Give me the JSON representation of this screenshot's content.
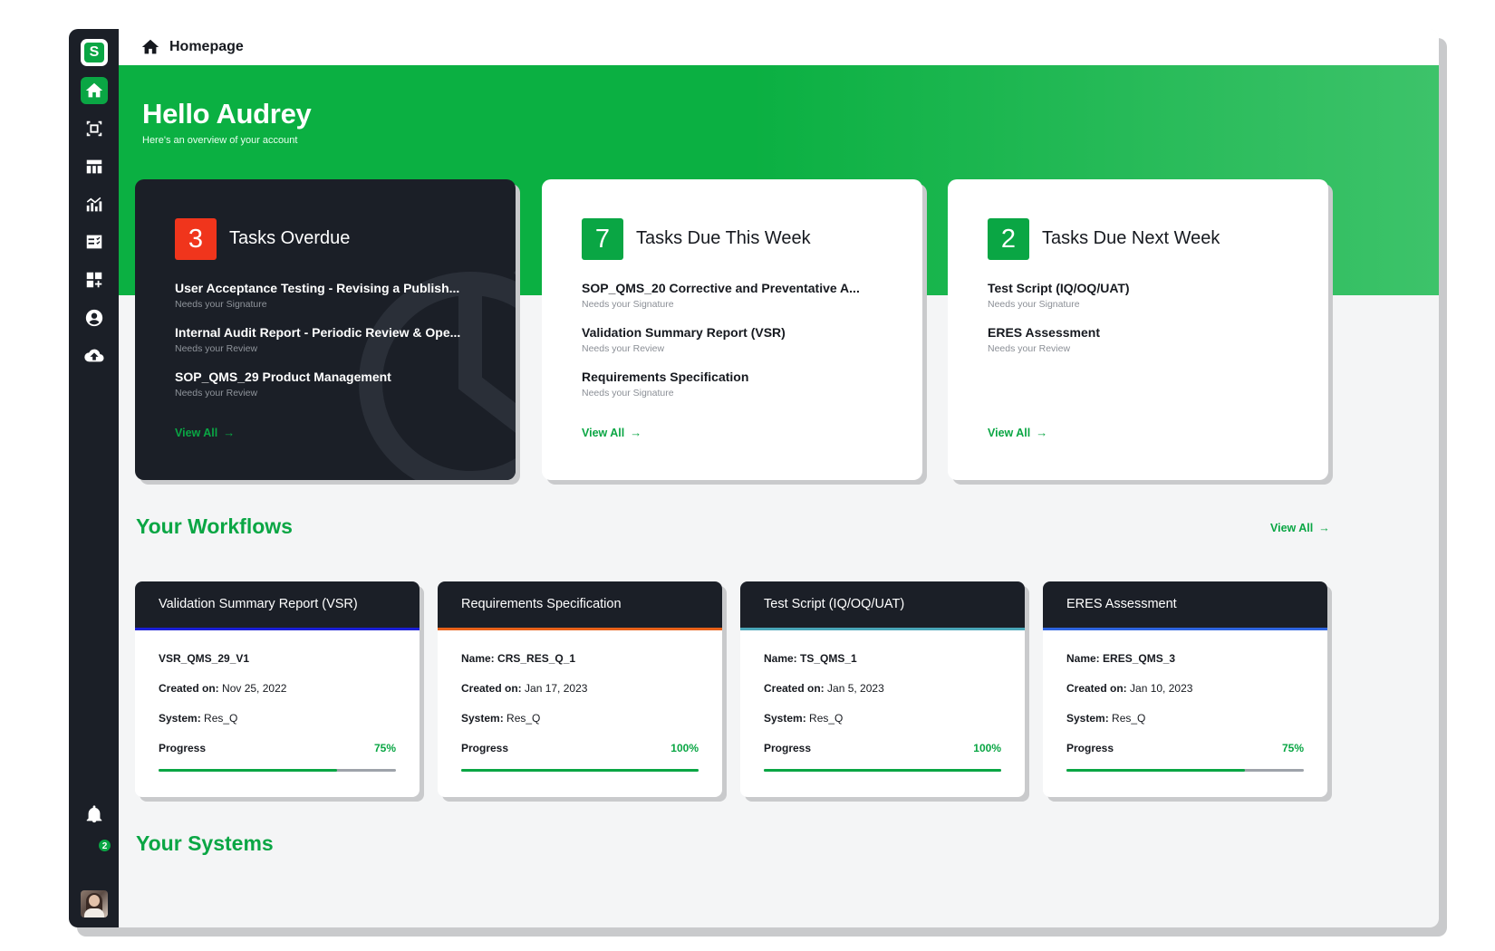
{
  "header": {
    "breadcrumb": "Homepage",
    "home_icon": "home-icon"
  },
  "sidebar": {
    "logo": "S",
    "items": [
      {
        "icon": "home-icon",
        "active": true
      },
      {
        "icon": "scan-icon",
        "active": false
      },
      {
        "icon": "table-icon",
        "active": false
      },
      {
        "icon": "analytics-icon",
        "active": false
      },
      {
        "icon": "checklist-icon",
        "active": false
      },
      {
        "icon": "dashboard-add-icon",
        "active": false
      },
      {
        "icon": "account-circle-icon",
        "active": false
      },
      {
        "icon": "cloud-upload-icon",
        "active": false
      }
    ],
    "notification_count": "2",
    "bell_icon": "bell-icon"
  },
  "hero": {
    "greeting": "Hello Audrey",
    "subtitle": "Here's an overview of your account"
  },
  "task_cards": [
    {
      "count": "3",
      "title": "Tasks Overdue",
      "theme": "dark",
      "tasks": [
        {
          "name": "User Acceptance Testing - Revising a Publish...",
          "status": "Needs your Signature"
        },
        {
          "name": "Internal Audit Report - Periodic Review & Ope...",
          "status": "Needs your Review"
        },
        {
          "name": "SOP_QMS_29 Product Management",
          "status": "Needs your Review"
        }
      ],
      "view_all": "View All"
    },
    {
      "count": "7",
      "title": "Tasks Due This Week",
      "theme": "light",
      "tasks": [
        {
          "name": "SOP_QMS_20 Corrective and Preventative A...",
          "status": "Needs your Signature"
        },
        {
          "name": "Validation Summary Report (VSR)",
          "status": "Needs your Review"
        },
        {
          "name": "Requirements Specification",
          "status": "Needs your Signature"
        }
      ],
      "view_all": "View All"
    },
    {
      "count": "2",
      "title": "Tasks Due Next Week",
      "theme": "light",
      "tasks": [
        {
          "name": "Test Script (IQ/OQ/UAT)",
          "status": "Needs your Signature"
        },
        {
          "name": "ERES Assessment",
          "status": "Needs your Review"
        }
      ],
      "view_all": "View All"
    }
  ],
  "workflows": {
    "title": "Your Workflows",
    "view_all": "View All",
    "cards": [
      {
        "title": "Validation Summary Report (VSR)",
        "accent": "#1b1fd6",
        "name": "VSR_QMS_29_V1",
        "created_label": "Created on:",
        "created": "Nov 25, 2022",
        "system_label": "System:",
        "system": "Res_Q",
        "progress_label": "Progress",
        "progress": "75%",
        "progress_value": 0.75
      },
      {
        "title": "Requirements Specification",
        "accent": "#e8621a",
        "name_label": "Name:",
        "name": "CRS_RES_Q_1",
        "created_label": "Created on:",
        "created": "Jan 17, 2023",
        "system_label": "System:",
        "system": "Res_Q",
        "progress_label": "Progress",
        "progress": "100%",
        "progress_value": 1.0
      },
      {
        "title": "Test Script (IQ/OQ/UAT)",
        "accent": "#4aa6b8",
        "name_label": "Name:",
        "name": "TS_QMS_1",
        "created_label": "Created on:",
        "created": "Jan 5, 2023",
        "system_label": "System:",
        "system": "Res_Q",
        "progress_label": "Progress",
        "progress": "100%",
        "progress_value": 1.0
      },
      {
        "title": "ERES Assessment",
        "accent": "#2f64e0",
        "name_label": "Name:",
        "name": "ERES_QMS_3",
        "created_label": "Created on:",
        "created": "Jan 10, 2023",
        "system_label": "System:",
        "system": "Res_Q",
        "progress_label": "Progress",
        "progress": "75%",
        "progress_value": 0.75
      }
    ]
  },
  "systems": {
    "title": "Your Systems"
  },
  "colors": {
    "brand_green": "#0aa644",
    "dark": "#1b1f27",
    "overdue_red": "#f0351c"
  }
}
